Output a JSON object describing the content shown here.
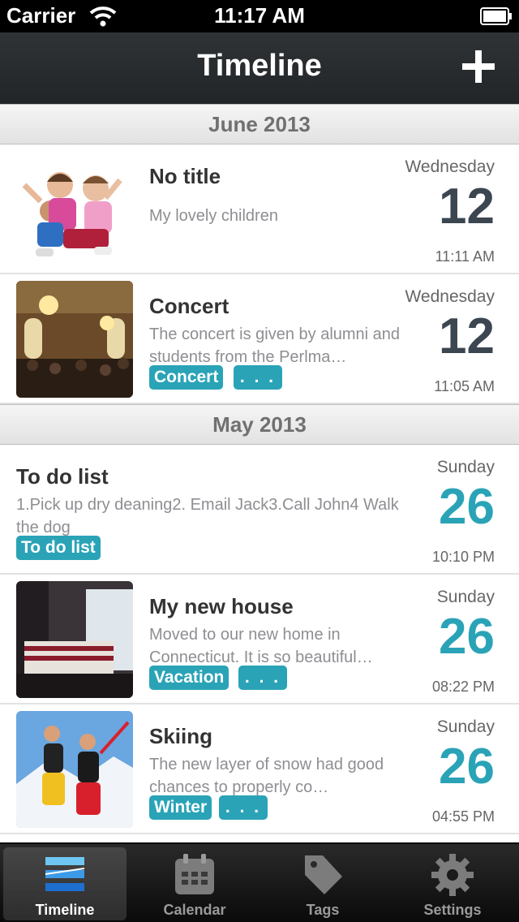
{
  "status": {
    "carrier": "Carrier",
    "time": "11:17 AM"
  },
  "nav": {
    "title": "Timeline"
  },
  "sections": [
    {
      "title": "June 2013"
    },
    {
      "title": "May 2013"
    }
  ],
  "entries": [
    {
      "title": "No title",
      "body": "My lovely children",
      "weekday": "Wednesday",
      "day": "12",
      "time": "11:11 AM",
      "tags": []
    },
    {
      "title": "Concert",
      "body": "The concert is given by alumni and students from the Perlma…",
      "weekday": "Wednesday",
      "day": "12",
      "time": "11:05 AM",
      "tags": [
        "Concert",
        ". . ."
      ]
    },
    {
      "title": "To do list",
      "body": "1.Pick up dry deaning2. Email Jack3.Call John4 Walk the dog",
      "weekday": "Sunday",
      "day": "26",
      "time": "10:10 PM",
      "tags": [
        "To do list"
      ]
    },
    {
      "title": "My new house",
      "body": "Moved to our new home in Connecticut. It is so beautiful…",
      "weekday": "Sunday",
      "day": "26",
      "time": "08:22 PM",
      "tags": [
        "Vacation",
        ". . ."
      ]
    },
    {
      "title": "Skiing",
      "body": "The new layer of snow had good chances to properly co…",
      "weekday": "Sunday",
      "day": "26",
      "time": "04:55 PM",
      "tags": [
        "Winter",
        ". . ."
      ]
    }
  ],
  "tabs": [
    {
      "label": "Timeline",
      "icon": "timeline-icon"
    },
    {
      "label": "Calendar",
      "icon": "calendar-icon"
    },
    {
      "label": "Tags",
      "icon": "tag-icon"
    },
    {
      "label": "Settings",
      "icon": "gear-icon"
    }
  ],
  "colors": {
    "accent": "#2aa3b7",
    "navbar": "#2a2d30",
    "date_dark": "#3c4651"
  }
}
